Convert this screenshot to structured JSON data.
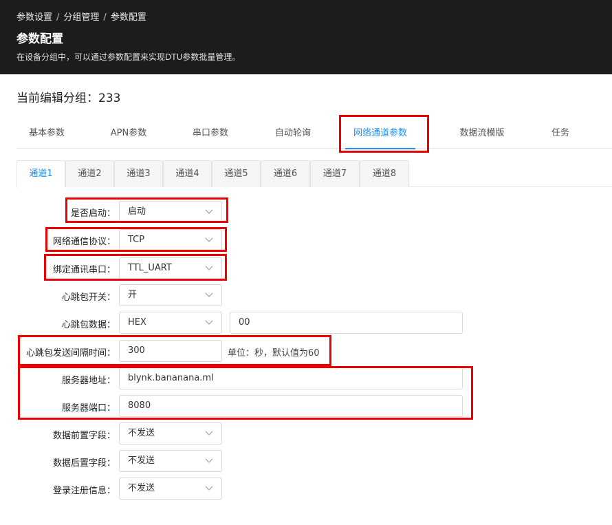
{
  "breadcrumb": [
    "参数设置",
    "分组管理",
    "参数配置"
  ],
  "breadcrumb_sep": "/",
  "page": {
    "title": "参数配置",
    "description": "在设备分组中，可以通过参数配置来实现DTU参数批量管理。"
  },
  "group": {
    "label": "当前编辑分组：",
    "value": "233"
  },
  "main_tabs": [
    {
      "label": "基本参数"
    },
    {
      "label": "APN参数"
    },
    {
      "label": "串口参数"
    },
    {
      "label": "自动轮询"
    },
    {
      "label": "网络通道参数",
      "active": true
    },
    {
      "label": "数据流模版"
    },
    {
      "label": "任务"
    }
  ],
  "channel_tabs": [
    {
      "label": "通道1",
      "active": true
    },
    {
      "label": "通道2"
    },
    {
      "label": "通道3"
    },
    {
      "label": "通道4"
    },
    {
      "label": "通道5"
    },
    {
      "label": "通道6"
    },
    {
      "label": "通道7"
    },
    {
      "label": "通道8"
    }
  ],
  "form": {
    "enabled": {
      "label": "是否启动：",
      "value": "启动"
    },
    "protocol": {
      "label": "网络通信协议：",
      "value": "TCP"
    },
    "serial": {
      "label": "绑定通讯串口：",
      "value": "TTL_UART"
    },
    "heartbeat_switch": {
      "label": "心跳包开关：",
      "value": "开"
    },
    "heartbeat_data": {
      "label": "心跳包数据：",
      "format": "HEX",
      "value": "00"
    },
    "heartbeat_interval": {
      "label": "心跳包发送间隔时间：",
      "value": "300",
      "hint": "单位：秒，默认值为60"
    },
    "server_address": {
      "label": "服务器地址：",
      "value": "blynk.bananana.ml"
    },
    "server_port": {
      "label": "服务器端口：",
      "value": "8080"
    },
    "data_prefix": {
      "label": "数据前置字段：",
      "value": "不发送"
    },
    "data_suffix": {
      "label": "数据后置字段：",
      "value": "不发送"
    },
    "login_info": {
      "label": "登录注册信息：",
      "value": "不发送"
    }
  },
  "colors": {
    "header_bg": "#1c1c1c",
    "accent": "#1890ff",
    "highlight": "#ee0000"
  }
}
